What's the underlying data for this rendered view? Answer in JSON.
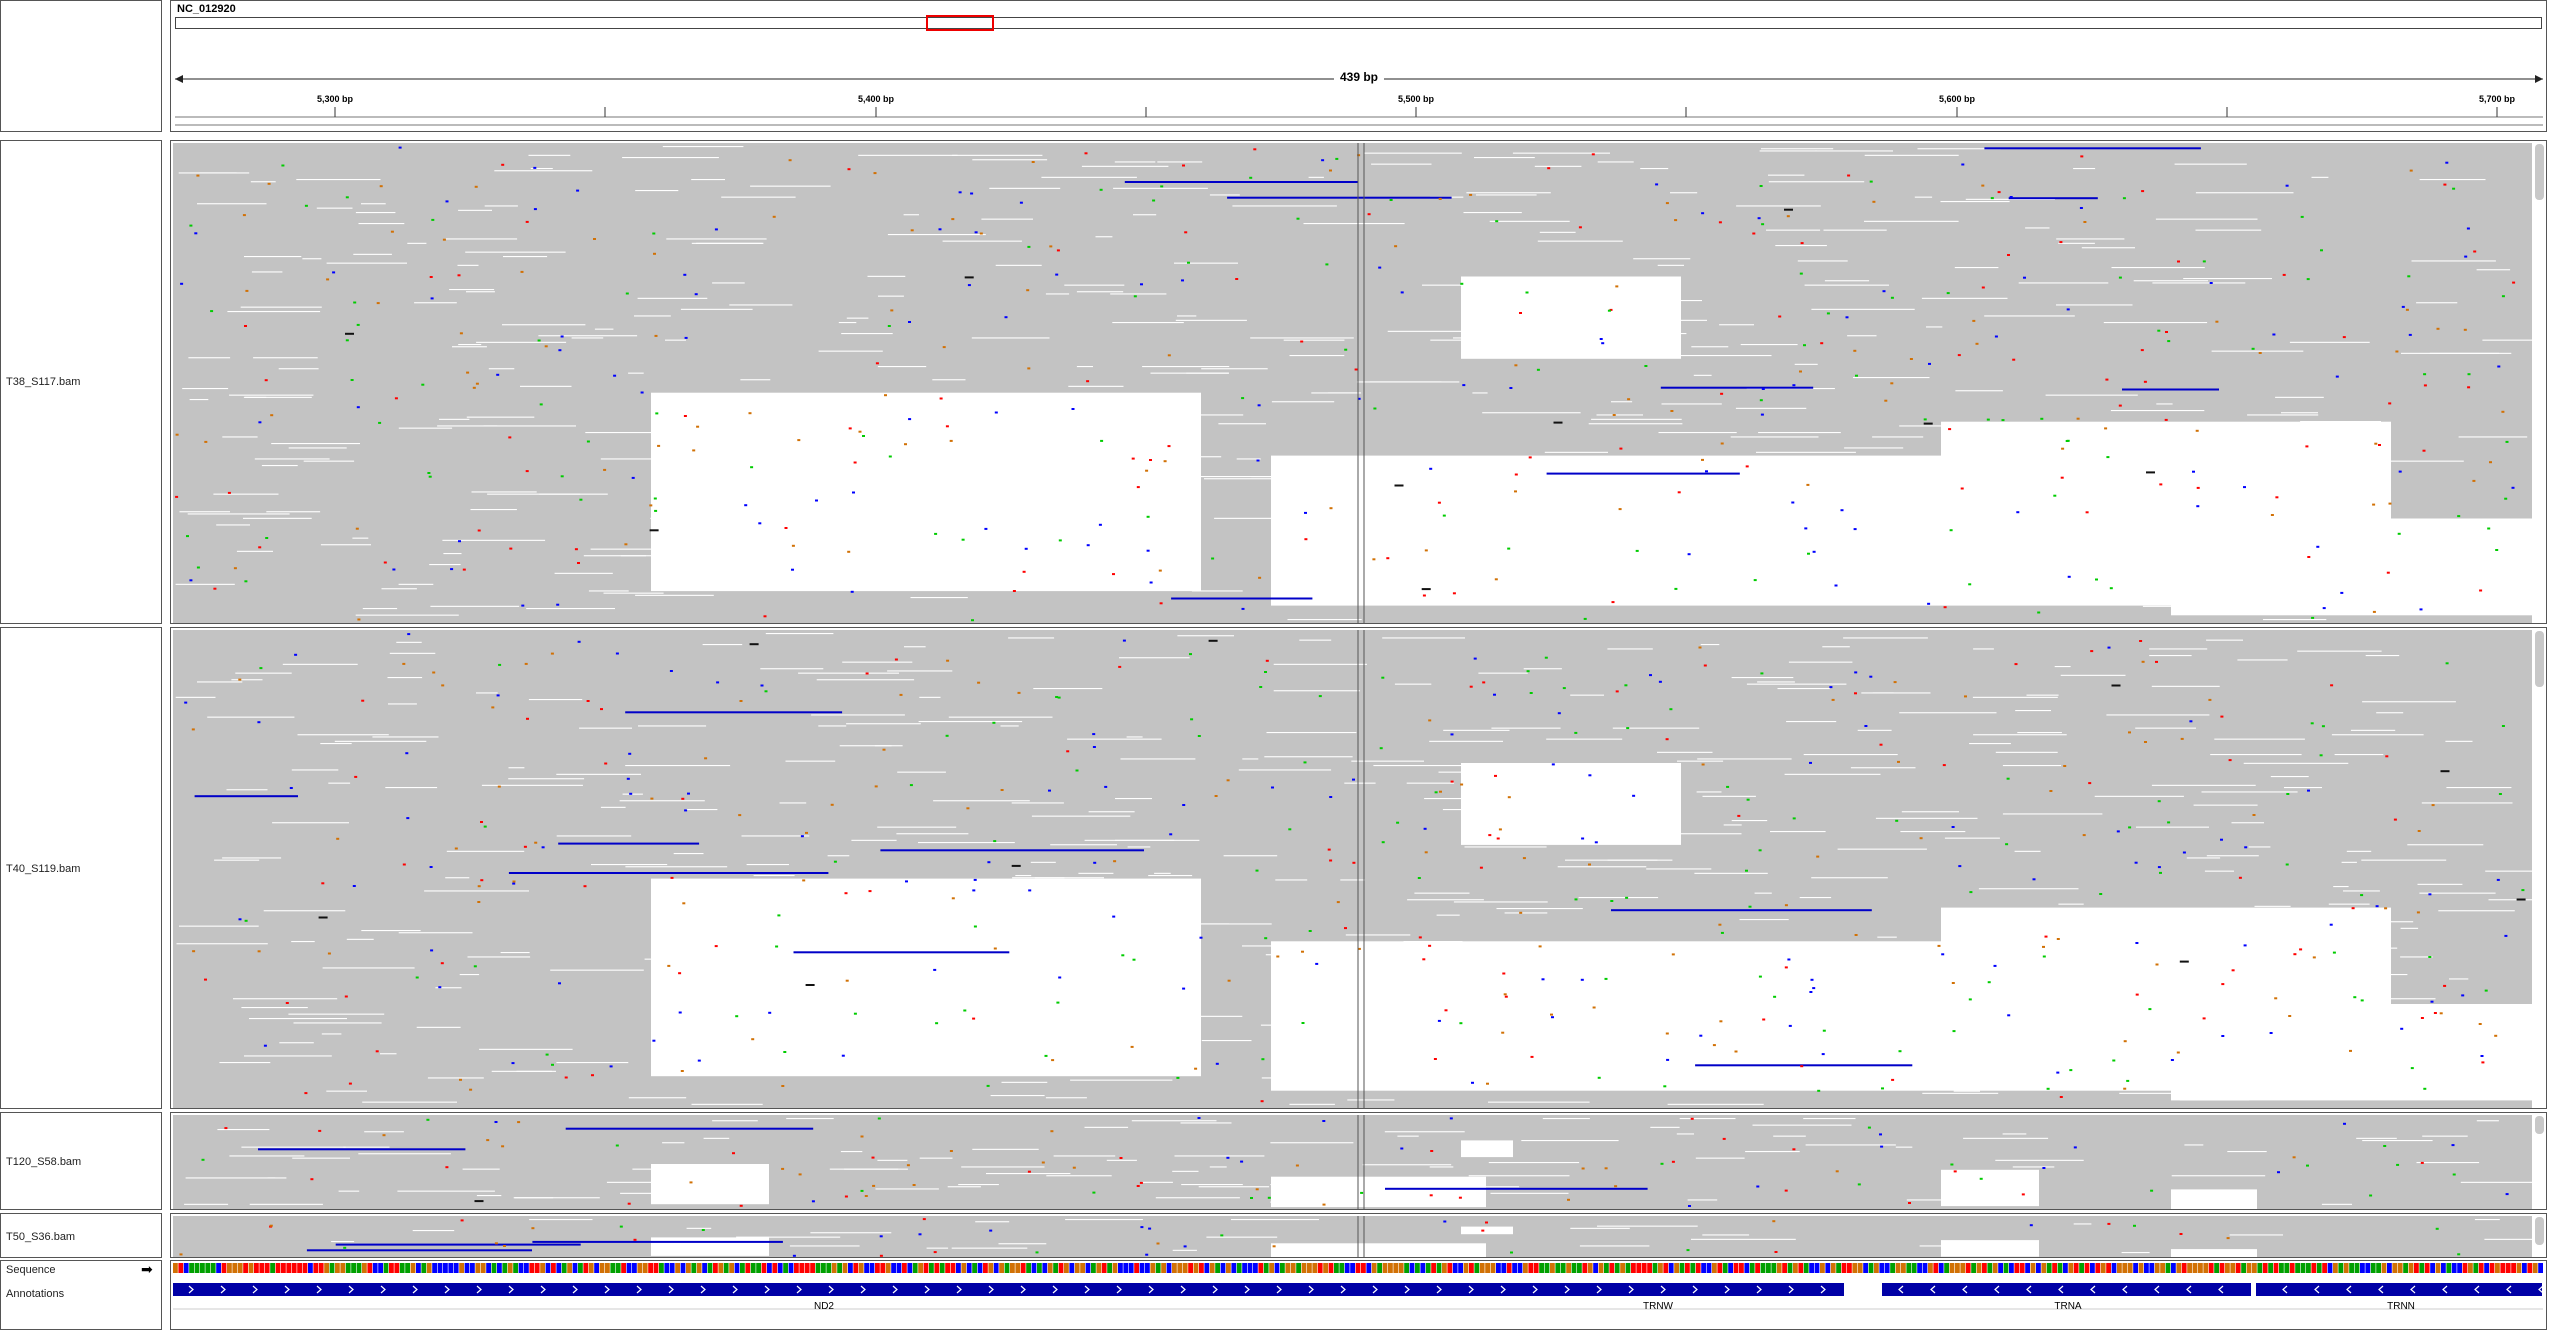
{
  "genome": {
    "chromosome": "NC_012920"
  },
  "ruler": {
    "span": "439 bp",
    "ticks": [
      "5,300 bp",
      "5,400 bp",
      "5,500 bp",
      "5,600 bp",
      "5,700 bp"
    ]
  },
  "tracks": [
    {
      "name": "T38_S117.bam"
    },
    {
      "name": "T40_S119.bam"
    },
    {
      "name": "T120_S58.bam"
    },
    {
      "name": "T50_S36.bam"
    }
  ],
  "sequence_track": {
    "label": "Sequence"
  },
  "annotation_track": {
    "label": "Annotations",
    "features": [
      "ND2",
      "TRNW",
      "TRNA",
      "TRNN"
    ]
  },
  "colors": {
    "read": "#c3c3c3",
    "deletion_bar": "#0000c8",
    "insertion": "#7a00ff",
    "mismatch_A": "#00cc00",
    "mismatch_C": "#0000ff",
    "mismatch_G": "#d17105",
    "mismatch_T": "#ff0000",
    "ideogram_box": "#e00000",
    "gene": "#0000a6"
  }
}
